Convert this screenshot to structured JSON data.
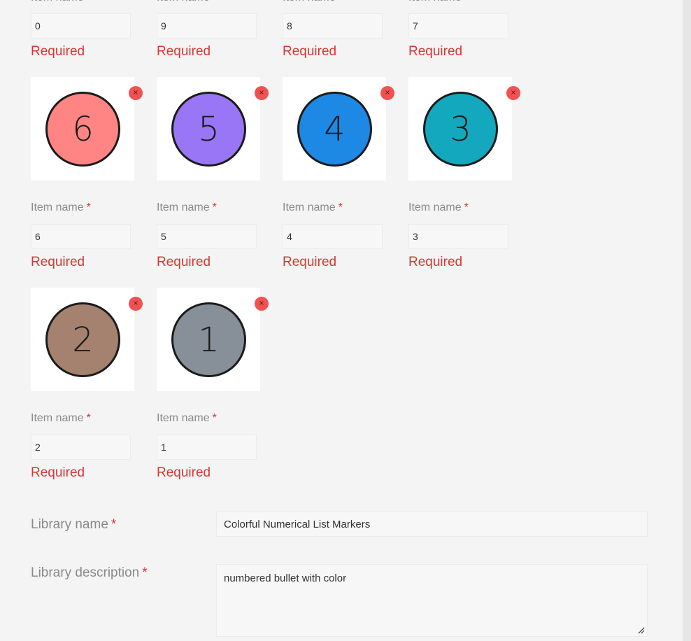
{
  "colors": {
    "error": "#d93535",
    "remove_button": "#f05252",
    "page_background": "#f4f4f4"
  },
  "item_label": "Item name",
  "required_star": "*",
  "error_text": "Required",
  "remove_icon": "×",
  "top_row_values": [
    "0",
    "9",
    "8",
    "7"
  ],
  "items": [
    {
      "value": "6",
      "numeral": "6",
      "color": "#ff8585"
    },
    {
      "value": "5",
      "numeral": "5",
      "color": "#9876f5"
    },
    {
      "value": "4",
      "numeral": "4",
      "color": "#1e88e5"
    },
    {
      "value": "3",
      "numeral": "3",
      "color": "#14a8bf"
    },
    {
      "value": "2",
      "numeral": "2",
      "color": "#a5816f"
    },
    {
      "value": "1",
      "numeral": "1",
      "color": "#878f99"
    }
  ],
  "library": {
    "name_label": "Library name",
    "name_value": "Colorful Numerical List Markers",
    "description_label": "Library description",
    "description_value": "numbered bullet with color"
  }
}
